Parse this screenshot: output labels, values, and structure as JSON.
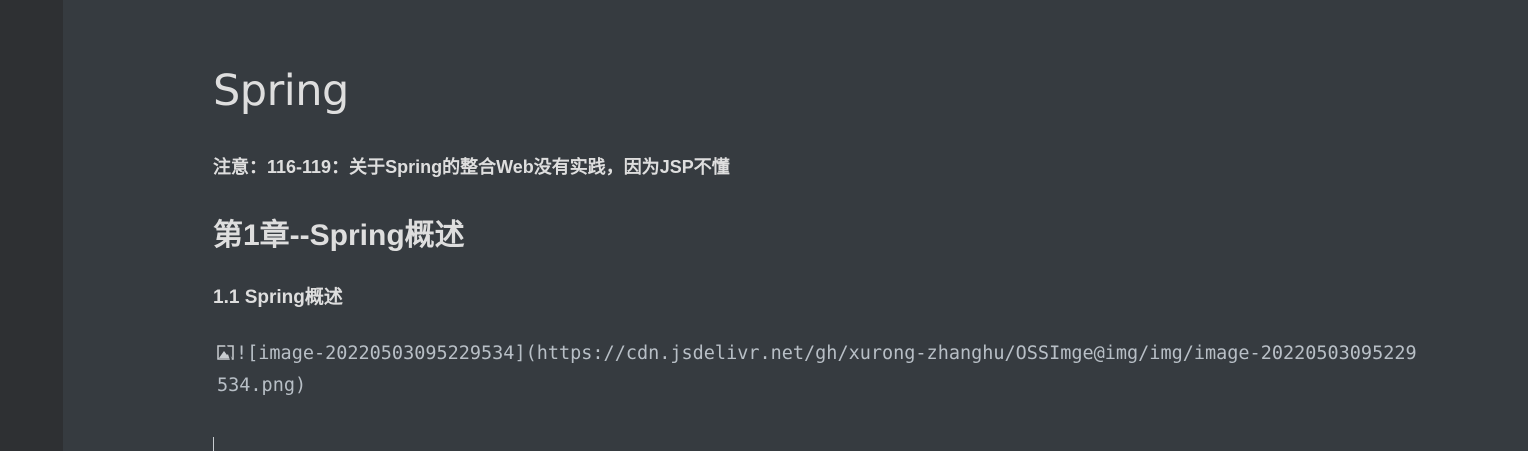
{
  "document": {
    "title": "Spring",
    "note": "注意：116-119：关于Spring的整合Web没有实践，因为JSP不懂",
    "chapter_heading": "第1章--Spring概述",
    "section_heading": "1.1 Spring概述",
    "image_markdown": "![image-20220503095229534](https://cdn.jsdelivr.net/gh/xurong-zhanghu/OSSImge@img/img/image-20220503095229534.png)"
  },
  "icons": {
    "broken_image": "broken-image-icon"
  },
  "colors": {
    "background": "#363b40",
    "sidebar": "#2e3033",
    "heading_text": "#dedede",
    "body_text": "#b8bfc6"
  }
}
